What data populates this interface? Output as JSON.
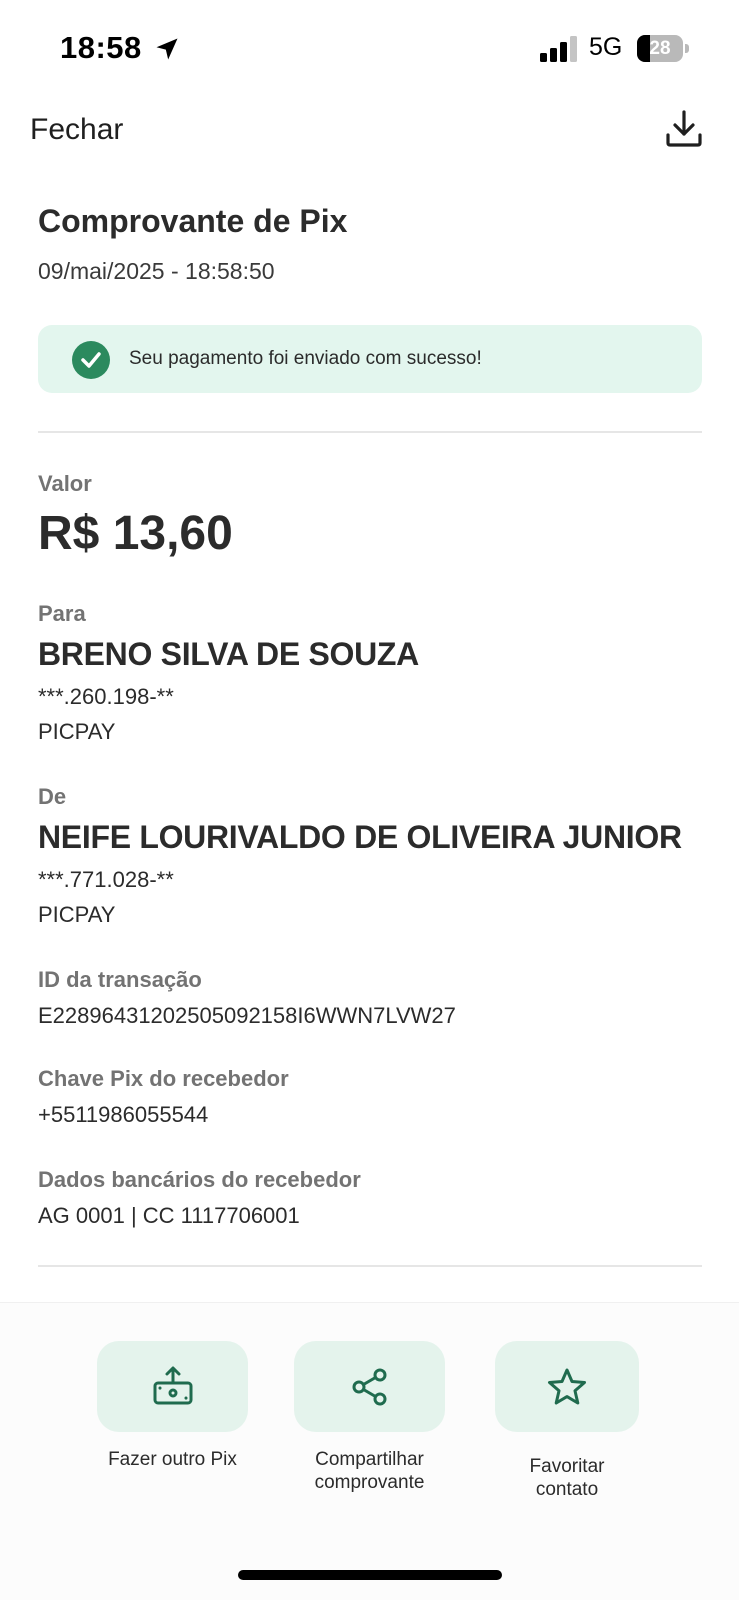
{
  "status_bar": {
    "time": "18:58",
    "network": "5G",
    "battery_level": "28",
    "battery_fraction": 0.28
  },
  "nav": {
    "close_label": "Fechar",
    "download_icon": "download-icon"
  },
  "header": {
    "title": "Comprovante de Pix",
    "datetime": "09/mai/2025 - 18:58:50"
  },
  "banner": {
    "message": "Seu pagamento foi enviado com sucesso!",
    "icon": "check-icon",
    "color": "#2b8a5e",
    "background": "#e3f6ee"
  },
  "valor": {
    "label": "Valor",
    "amount": "R$ 13,60"
  },
  "para": {
    "label": "Para",
    "name": "BRENO SILVA DE SOUZA",
    "document": "***.260.198-**",
    "institution": "PICPAY"
  },
  "de": {
    "label": "De",
    "name": "NEIFE LOURIVALDO DE OLIVEIRA JUNIOR",
    "document": "***.771.028-**",
    "institution": "PICPAY"
  },
  "transaction": {
    "id_label": "ID da transação",
    "id_value": "E22896431202505092158I6WWN7LVW27",
    "key_label": "Chave Pix do recebedor",
    "key_value": "+5511986055544",
    "bank_label": "Dados bancários do recebedor",
    "bank_value": "AG 0001 | CC 1117706001"
  },
  "actions": [
    {
      "label_line1": "Fazer outro Pix",
      "label_line2": "",
      "icon": "send-money-icon"
    },
    {
      "label_line1": "Compartilhar",
      "label_line2": "comprovante",
      "icon": "share-icon"
    },
    {
      "label_line1": "Favoritar",
      "label_line2": "contato",
      "icon": "star-icon"
    }
  ],
  "accent_color": "#1f6b4e"
}
